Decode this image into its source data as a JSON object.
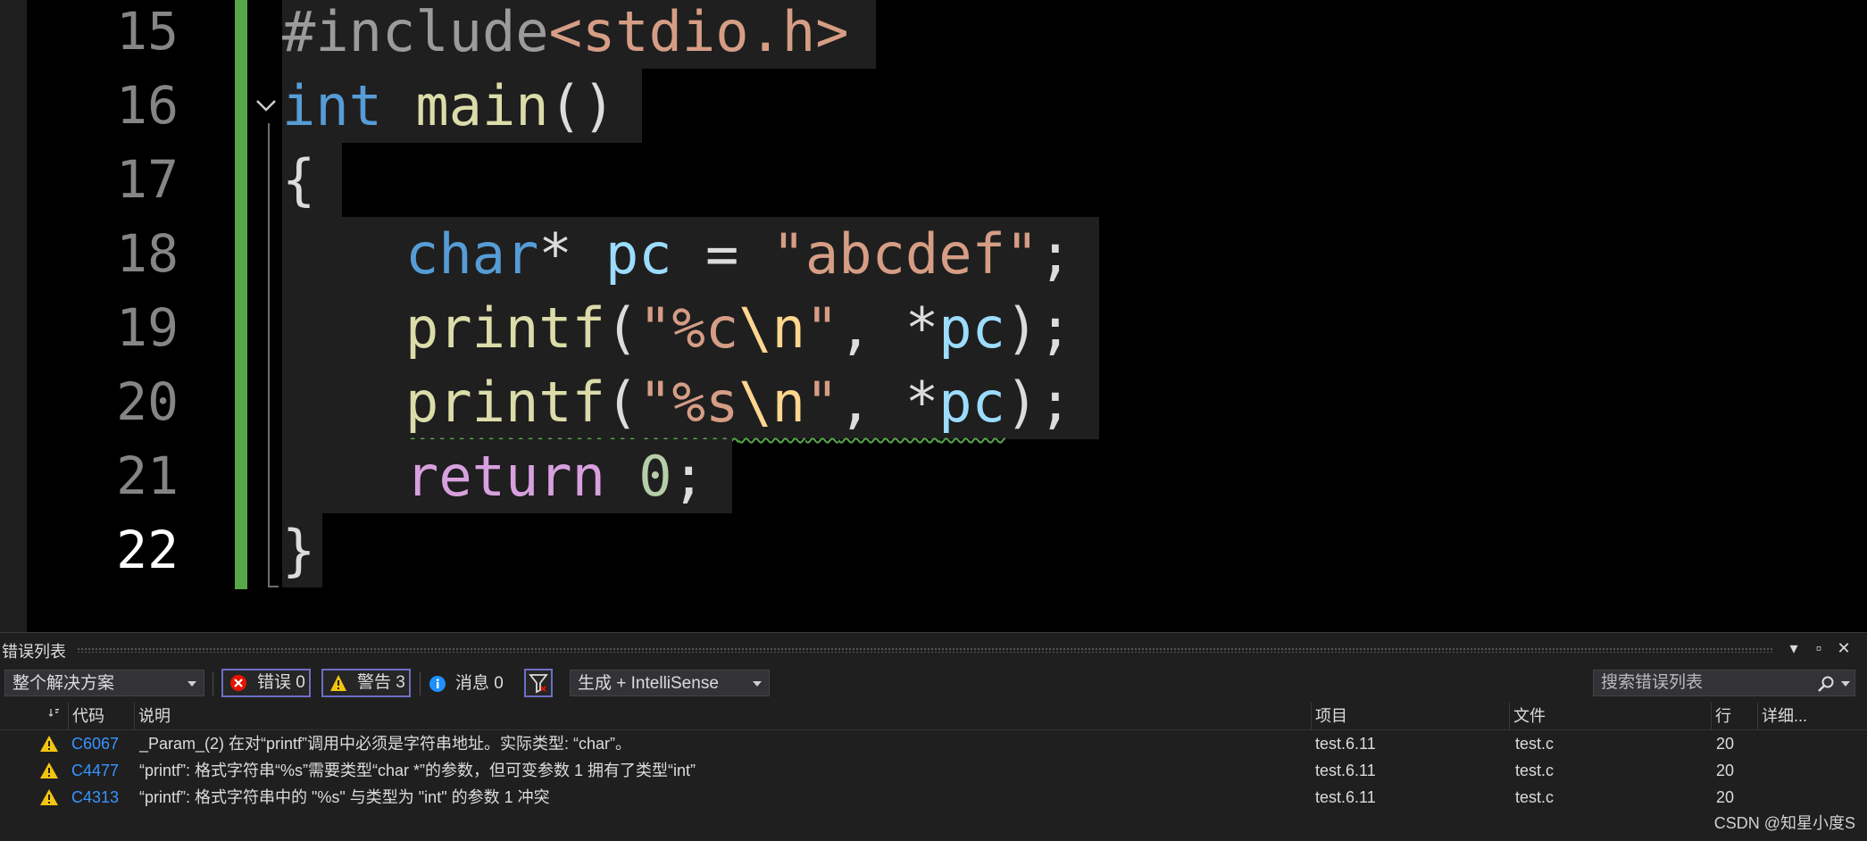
{
  "editor": {
    "line_numbers": [
      "15",
      "16",
      "17",
      "18",
      "19",
      "20",
      "21",
      "22"
    ],
    "lines": {
      "l15": [
        "#include",
        "<stdio.h>"
      ],
      "l16": [
        "int",
        " ",
        "main",
        "()"
      ],
      "l17": [
        "{"
      ],
      "l18": [
        "char",
        "* ",
        "pc",
        " = ",
        "\"abcdef\"",
        ";"
      ],
      "l19": [
        "printf",
        "(",
        "\"%c",
        "\\n",
        "\"",
        ", *",
        "pc",
        ");"
      ],
      "l20": [
        "printf",
        "(",
        "\"%s",
        "\\n",
        "\"",
        ", *",
        "pc",
        ");"
      ],
      "l21": [
        "return",
        " ",
        "0",
        ";"
      ],
      "l22": [
        "}"
      ]
    }
  },
  "error_panel": {
    "title": "错误列表",
    "window_buttons": [
      "▾",
      "▫",
      "✕"
    ],
    "scope": "整个解决方案",
    "errors_label": "错误 0",
    "warnings_label": "警告 3",
    "messages_label": "消息 0",
    "build_filter": "生成 + IntelliSense",
    "search_placeholder": "搜索错误列表",
    "columns": {
      "code": "代码",
      "description": "说明",
      "project": "项目",
      "file": "文件",
      "line": "行",
      "details": "详细..."
    },
    "rows": [
      {
        "code": "C6067",
        "description": "_Param_(2) 在对“printf”调用中必须是字符串地址。实际类型: “char”。",
        "project": "test.6.11",
        "file": "test.c",
        "line": "20"
      },
      {
        "code": "C4477",
        "description": "“printf”: 格式字符串“%s”需要类型“char *”的参数，但可变参数 1 拥有了类型“int”",
        "project": "test.6.11",
        "file": "test.c",
        "line": "20"
      },
      {
        "code": "C4313",
        "description": "“printf”: 格式字符串中的 \"%s\" 与类型为 \"int\" 的参数 1 冲突",
        "project": "test.6.11",
        "file": "test.c",
        "line": "20"
      }
    ]
  },
  "watermark": "CSDN @知星小度S",
  "colors": {
    "keyword": "#569cd6",
    "function": "#dcdcaa",
    "string": "#d69d85",
    "variable": "#9cdcfe",
    "control": "#d8a0df",
    "change_bar": "#57a64a",
    "warning": "#f2c50f",
    "error": "#e51400",
    "info": "#1e90ff"
  }
}
